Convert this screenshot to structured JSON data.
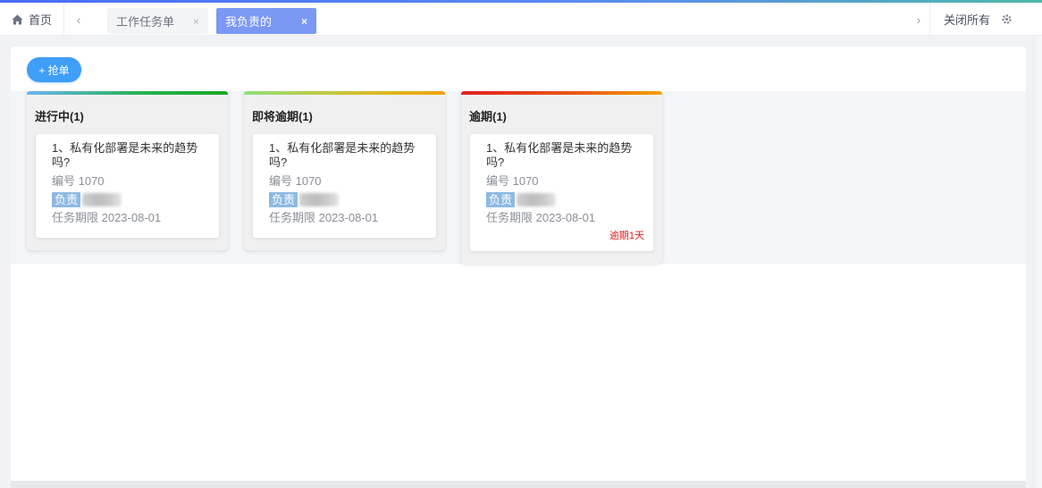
{
  "tabbar": {
    "home_label": "首页",
    "tabs": [
      {
        "label": "工作任务单",
        "close": "×",
        "active": false
      },
      {
        "label": "我负责的",
        "close": "×",
        "active": true
      }
    ],
    "prev_arrow": "‹",
    "next_arrow": "›",
    "close_all_label": "关闭所有"
  },
  "toolbar": {
    "grab_label": "+ 抢单"
  },
  "columns": [
    {
      "title": "进行中(1)",
      "card": {
        "title": "1、私有化部署是未来的趋势吗?",
        "code": "编号 1070",
        "owner_tag": "负责",
        "deadline": "任务期限 2023-08-01",
        "overdue_note": ""
      }
    },
    {
      "title": "即将逾期(1)",
      "card": {
        "title": "1、私有化部署是未来的趋势吗?",
        "code": "编号 1070",
        "owner_tag": "负责",
        "deadline": "任务期限 2023-08-01",
        "overdue_note": ""
      }
    },
    {
      "title": "逾期(1)",
      "card": {
        "title": "1、私有化部署是未来的趋势吗?",
        "code": "编号 1070",
        "owner_tag": "负责",
        "deadline": "任务期限 2023-08-01",
        "overdue_note": "逾期1天"
      }
    }
  ],
  "colors": {
    "accent": "#3e9ef8",
    "active_tab": "#7a98f4",
    "overdue": "#e02020",
    "in_progress_bar": "#1aa827",
    "due_soon_bar": "#f2a20d"
  }
}
